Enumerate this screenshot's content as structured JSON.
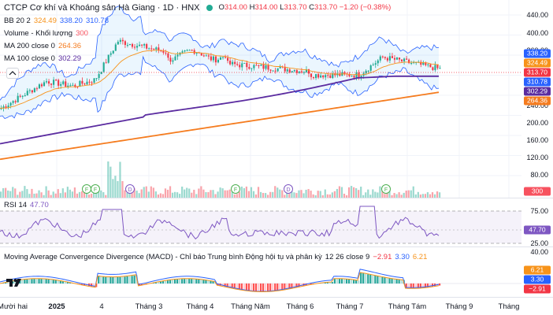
{
  "header": {
    "title": "CTCP Cơ khí và Khoáng sản Hà Giang · 1D · HNX",
    "ohlc": {
      "o_label": "O",
      "o": "314.00",
      "h_label": "H",
      "h": "314.00",
      "l_label": "L",
      "l": "313.70",
      "c_label": "C",
      "c": "313.70",
      "change": "−1.20 (−0.38%)"
    }
  },
  "indicators": [
    {
      "label": "BB 20 2",
      "values": [
        "324.49",
        "338.20",
        "310.78"
      ],
      "colors": [
        "#f7931a",
        "#2962ff",
        "#2962ff"
      ]
    },
    {
      "label": "Volume - Khối lượng",
      "values": [
        "300"
      ],
      "colors": [
        "#f7525f"
      ]
    },
    {
      "label": "MA 200 close 0",
      "values": [
        "264.36"
      ],
      "colors": [
        "#f57c1f"
      ]
    },
    {
      "label": "MA 100 close 0",
      "values": [
        "302.29"
      ],
      "colors": [
        "#5b2ca0"
      ]
    }
  ],
  "price_scale": {
    "ticks": [
      "440.00",
      "400.00",
      "360.00",
      "280.00",
      "240.00",
      "200.00",
      "160.00",
      "120.00",
      "80.00",
      "40.00"
    ]
  },
  "price_badges": [
    {
      "value": "338.20",
      "color": "#2962ff"
    },
    {
      "value": "324.49",
      "color": "#f7931a"
    },
    {
      "value": "313.70",
      "color": "#f23645"
    },
    {
      "value": "310.78",
      "color": "#2962ff"
    },
    {
      "value": "302.29",
      "color": "#5b2ca0"
    },
    {
      "value": "264.36",
      "color": "#f57c1f"
    },
    {
      "value": "300",
      "color": "#f7525f"
    }
  ],
  "rsi": {
    "label": "RSI 14",
    "value": "47.70",
    "ticks": [
      "75.00",
      "25.00"
    ],
    "badge": "47.70",
    "color": "#7e57c2"
  },
  "macd": {
    "label": "Moving Average Convergence Divergence (MACD) - Chỉ báo Trung bình Động hội tụ và phân kỳ",
    "params": "12 26 close 9",
    "values": [
      "−2.91",
      "3.30",
      "6.21"
    ],
    "colors": [
      "#f23645",
      "#2962ff",
      "#f7931a"
    ],
    "scale_top": "40.00",
    "badges": [
      {
        "value": "6.21",
        "color": "#f7931a"
      },
      {
        "value": "3.30",
        "color": "#2962ff"
      },
      {
        "value": "−2.91",
        "color": "#f23645"
      }
    ]
  },
  "event_markers": [
    "F",
    "F",
    "D",
    "F",
    "D",
    "F"
  ],
  "time_axis": [
    "Mười hai",
    "2025",
    "4",
    "Tháng 3",
    "Tháng 4",
    "Tháng Năm",
    "Tháng 6",
    "Tháng 7",
    "Tháng Tám",
    "Tháng 9",
    "Tháng"
  ],
  "icons": {
    "collapse": "chevron-up-icon",
    "logo": "tradingview-logo-icon",
    "live": "live-dot-icon"
  }
}
